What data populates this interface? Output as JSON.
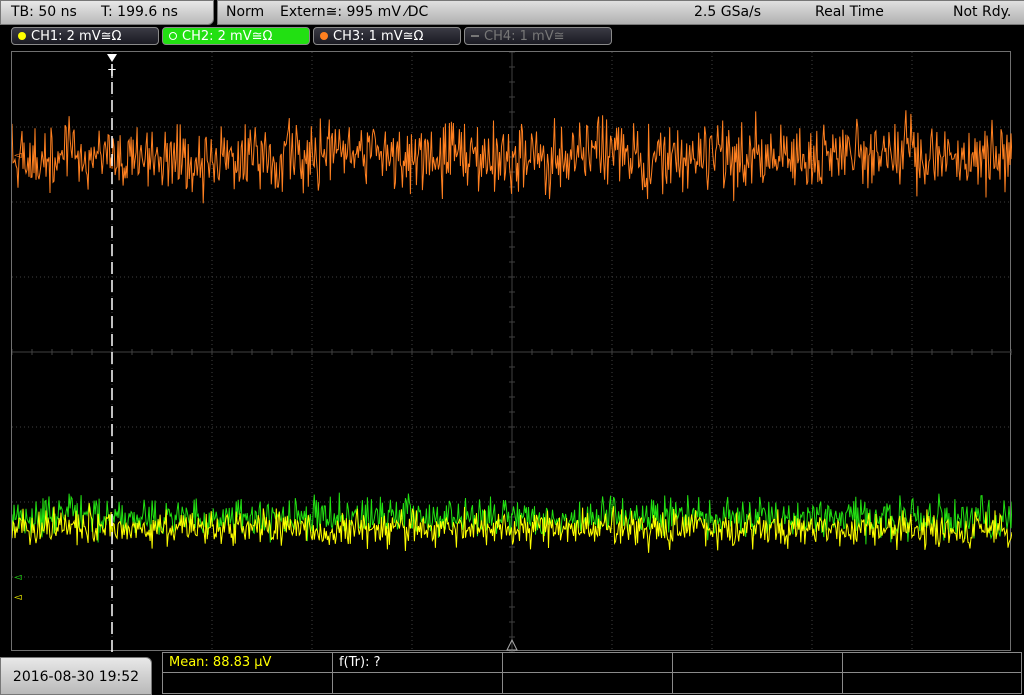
{
  "timebase": {
    "tb": "TB: 50 ns",
    "trigger_time": "T: 199.6 ns"
  },
  "status": {
    "mode": "Norm",
    "trigger": "Extern≅: 995 mV ⁄DC",
    "sample_rate": "2.5 GSa/s",
    "acq_mode": "Real Time",
    "state": "Not Rdy."
  },
  "channels": [
    {
      "label": "CH1: 2 mV≅Ω",
      "color": "#ffff00",
      "active": false,
      "enabled": true
    },
    {
      "label": "CH2: 2 mV≅Ω",
      "color": "#22e012",
      "active": true,
      "enabled": true
    },
    {
      "label": "CH3: 1 mV≅Ω",
      "color": "#ff8020",
      "active": false,
      "enabled": true
    },
    {
      "label": "CH4: 1 mV≅",
      "color": "#777777",
      "active": false,
      "enabled": false
    }
  ],
  "trigger_marker": "T",
  "waveforms": {
    "ch1": {
      "color": "#ffff00",
      "level_div": 1.65,
      "noise_div": 0.22
    },
    "ch2": {
      "color": "#22e012",
      "level_div": 1.8,
      "noise_div": 0.25
    },
    "ch3": {
      "color": "#ff8020",
      "level_div": 6.6,
      "noise_div": 0.45
    }
  },
  "grid": {
    "h_divs": 10,
    "v_divs": 8,
    "color": "#404040"
  },
  "date": "2016-08-30 19:52",
  "measurements": {
    "mean": "Mean: 88.83 µV",
    "ftr": "f(Tr): ?"
  }
}
